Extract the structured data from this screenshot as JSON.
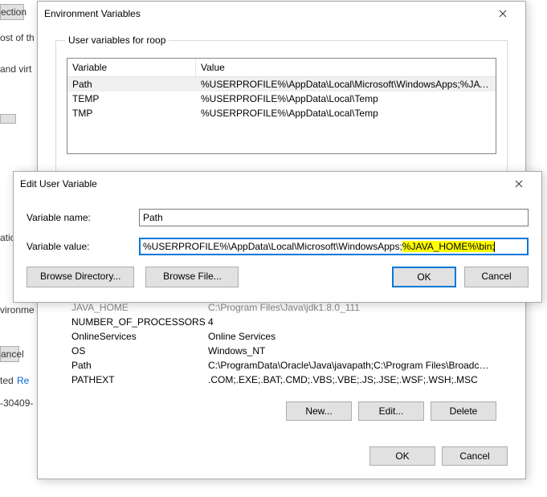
{
  "bg": {
    "ection_btn": "ection",
    "ost": "ost of th",
    "and_virt": "and virt",
    "ation": "ation",
    "ancel": "ancel",
    "ted": "ted",
    "re": "Re",
    "build": "-30409-",
    "viro": "vironme"
  },
  "env": {
    "title": "Environment Variables",
    "user_group": "User variables for roop",
    "headers": {
      "variable": "Variable",
      "value": "Value"
    },
    "user_rows": [
      {
        "var": "Path",
        "val": "%USERPROFILE%\\AppData\\Local\\Microsoft\\WindowsApps;%JAVA_..."
      },
      {
        "var": "TEMP",
        "val": "%USERPROFILE%\\AppData\\Local\\Temp"
      },
      {
        "var": "TMP",
        "val": "%USERPROFILE%\\AppData\\Local\\Temp"
      }
    ],
    "sys_rows": [
      {
        "var": "JAVA_HOME",
        "val": "C:\\Program Files\\Java\\jdk1.8.0_111"
      },
      {
        "var": "NUMBER_OF_PROCESSORS",
        "val": "4"
      },
      {
        "var": "OnlineServices",
        "val": "Online Services"
      },
      {
        "var": "OS",
        "val": "Windows_NT"
      },
      {
        "var": "Path",
        "val": "C:\\ProgramData\\Oracle\\Java\\javapath;C:\\Program Files\\Broadcom..."
      },
      {
        "var": "PATHEXT",
        "val": ".COM;.EXE;.BAT;.CMD;.VBS;.VBE;.JS;.JSE;.WSF;.WSH;.MSC"
      }
    ],
    "buttons": {
      "new": "New...",
      "edit": "Edit...",
      "delete": "Delete",
      "ok": "OK",
      "cancel": "Cancel"
    }
  },
  "edit": {
    "title": "Edit User Variable",
    "name_label": "Variable name:",
    "name_value": "Path",
    "value_label": "Variable value:",
    "value_prefix": "%USERPROFILE%\\AppData\\Local\\Microsoft\\WindowsApps;",
    "value_highlight": "%JAVA_HOME%\\bin;",
    "browse_dir": "Browse Directory...",
    "browse_file": "Browse File...",
    "ok": "OK",
    "cancel": "Cancel"
  }
}
